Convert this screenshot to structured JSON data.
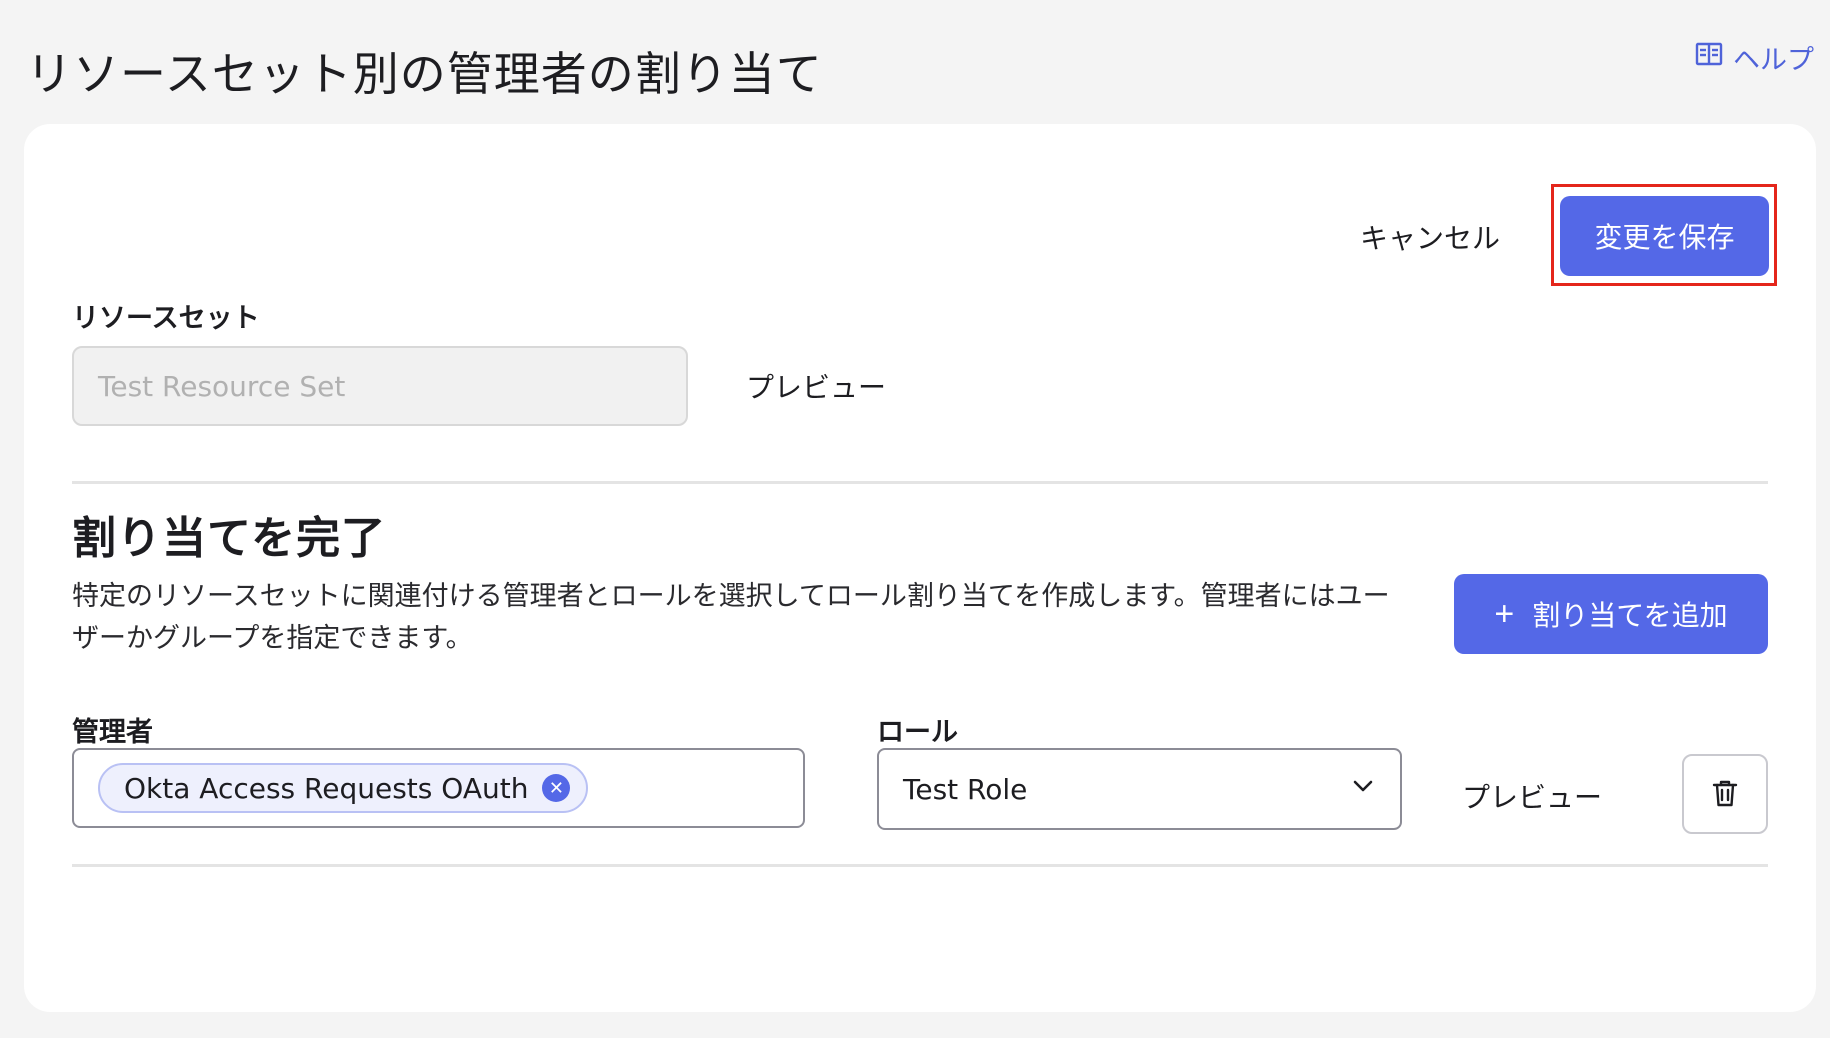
{
  "header": {
    "title": "リソースセット別の管理者の割り当て",
    "help_label": "ヘルプ"
  },
  "actions": {
    "cancel_label": "キャンセル",
    "save_label": "変更を保存"
  },
  "resource_set": {
    "label": "リソースセット",
    "value": "Test Resource Set",
    "preview_label": "プレビュー"
  },
  "assignment": {
    "title": "割り当てを完了",
    "description": "特定のリソースセットに関連付ける管理者とロールを選択してロール割り当てを作成します。管理者にはユーザーかグループを指定できます。",
    "add_label": "割り当てを追加",
    "admin_label": "管理者",
    "admin_chip": "Okta Access Requests OAuth",
    "role_label": "ロール",
    "role_value": "Test Role",
    "preview_label": "プレビュー"
  },
  "colors": {
    "primary": "#5468e7",
    "highlight": "#e4261b",
    "background": "#f4f4f4"
  },
  "icons": {
    "help": "book-icon",
    "chip_remove": "close-circle-icon",
    "select": "chevron-down-icon",
    "delete": "trash-icon"
  }
}
